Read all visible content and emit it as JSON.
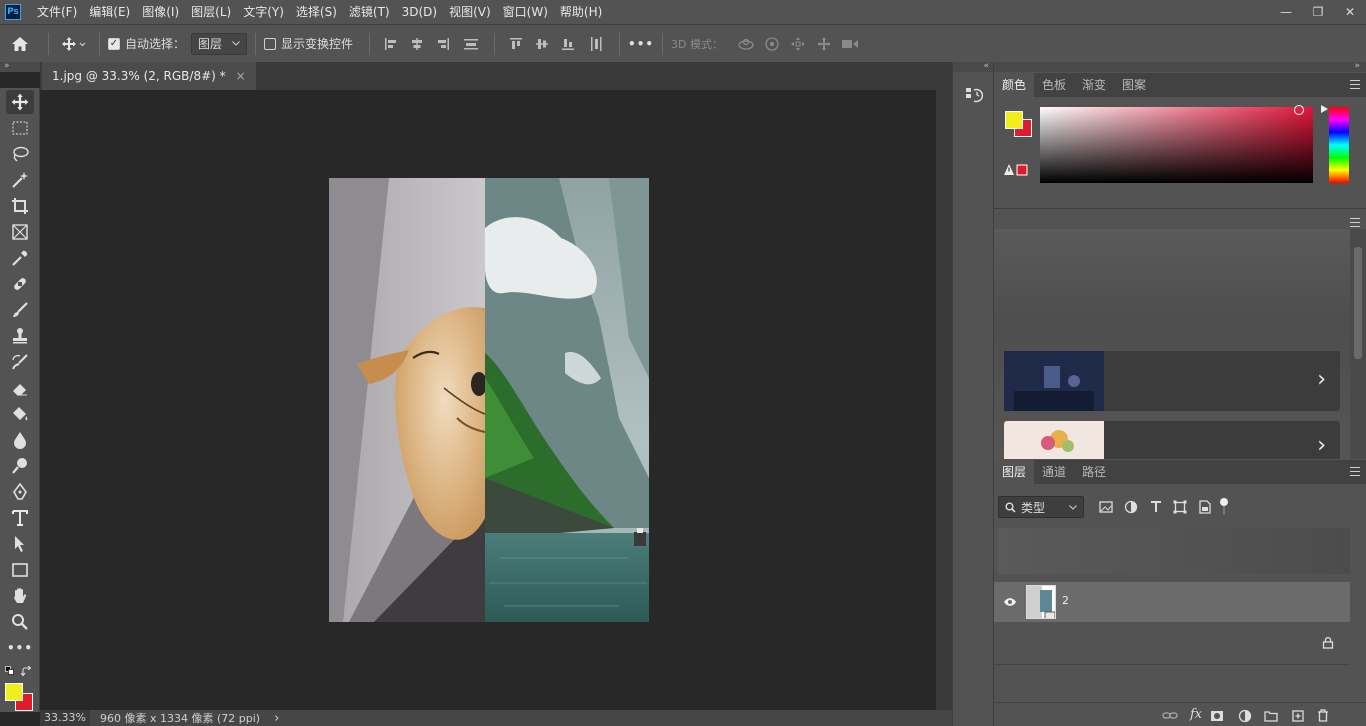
{
  "app": {
    "logo_text": "Ps",
    "menu": [
      "文件(F)",
      "编辑(E)",
      "图像(I)",
      "图层(L)",
      "文字(Y)",
      "选择(S)",
      "滤镜(T)",
      "3D(D)",
      "视图(V)",
      "窗口(W)",
      "帮助(H)"
    ],
    "window_controls": {
      "minimize": "—",
      "restore": "❐",
      "close": "✕"
    }
  },
  "options_bar": {
    "auto_select_label": "自动选择：",
    "auto_select_checked": true,
    "auto_select_target": "图层",
    "show_transform_label": "显示变换控件",
    "show_transform_checked": false,
    "more_label": "•••",
    "mode_3d_label": "3D 模式："
  },
  "document": {
    "tab_title": "1.jpg @ 33.3% (2, RGB/8#) *",
    "tab_close": "×"
  },
  "status_bar": {
    "zoom": "33.33%",
    "doc_info": "960 像素 x 1334 像素 (72 ppi)",
    "arrow": "›"
  },
  "toolbar": {
    "tools": [
      "move-tool",
      "marquee-tool",
      "lasso-tool",
      "magic-wand-tool",
      "crop-tool",
      "frame-tool",
      "eyedropper-tool",
      "healing-brush-tool",
      "brush-tool",
      "clone-stamp-tool",
      "history-brush-tool",
      "eraser-tool",
      "paint-bucket-tool",
      "blur-tool",
      "dodge-tool",
      "pen-tool",
      "type-tool",
      "path-selection-tool",
      "rectangle-tool",
      "hand-tool",
      "zoom-tool",
      "edit-toolbar"
    ],
    "foreground_color": "#f2ee1e",
    "background_color": "#e01b2b"
  },
  "color_panel": {
    "tabs": [
      "颜色",
      "色板",
      "渐变",
      "图案"
    ],
    "active_tab": "颜色",
    "foreground_color": "#f2ee1e",
    "background_color": "#e01b2b",
    "hue_color": "#e3163a"
  },
  "adjust_panel": {
    "card_arrow": "›"
  },
  "layers_panel": {
    "tabs": [
      "图层",
      "通道",
      "路径"
    ],
    "active_tab": "图层",
    "filter_label": "类型",
    "filter_icons": [
      "image-filter-icon",
      "adjustment-filter-icon",
      "type-filter-icon",
      "shape-filter-icon",
      "smart-object-filter-icon"
    ],
    "layers": [
      {
        "name": "2",
        "visible": true,
        "selected": true
      }
    ],
    "footer_icons": [
      "link-layers-icon",
      "fx-icon",
      "add-mask-icon",
      "adjustment-layer-icon",
      "new-group-icon",
      "new-layer-icon",
      "delete-layer-icon"
    ],
    "fx_label": "fx"
  }
}
